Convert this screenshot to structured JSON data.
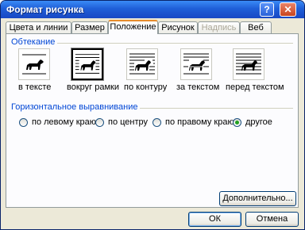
{
  "window": {
    "title": "Формат рисунка",
    "help_glyph": "?",
    "close_glyph": "✕"
  },
  "tabs": [
    {
      "label": "Цвета и линии",
      "state": "normal"
    },
    {
      "label": "Размер",
      "state": "normal"
    },
    {
      "label": "Положение",
      "state": "active"
    },
    {
      "label": "Рисунок",
      "state": "normal"
    },
    {
      "label": "Надпись",
      "state": "disabled"
    },
    {
      "label": "Веб",
      "state": "normal"
    }
  ],
  "wrapping": {
    "group_label": "Обтекание",
    "options": [
      {
        "label": "в тексте",
        "icon": "inline-dog-icon"
      },
      {
        "label": "вокруг рамки",
        "icon": "square-dog-icon",
        "selected": true
      },
      {
        "label": "по контуру",
        "icon": "tight-dog-icon"
      },
      {
        "label": "за текстом",
        "icon": "behind-dog-icon"
      },
      {
        "label": "перед текстом",
        "icon": "front-dog-icon"
      }
    ]
  },
  "alignment": {
    "group_label": "Горизонтальное выравнивание",
    "options": [
      {
        "label": "по левому краю"
      },
      {
        "label": "по центру"
      },
      {
        "label": "по правому краю"
      },
      {
        "label": "другое",
        "checked": true
      }
    ]
  },
  "buttons": {
    "advanced": "Дополнительно...",
    "ok": "ОК",
    "cancel": "Отмена"
  }
}
